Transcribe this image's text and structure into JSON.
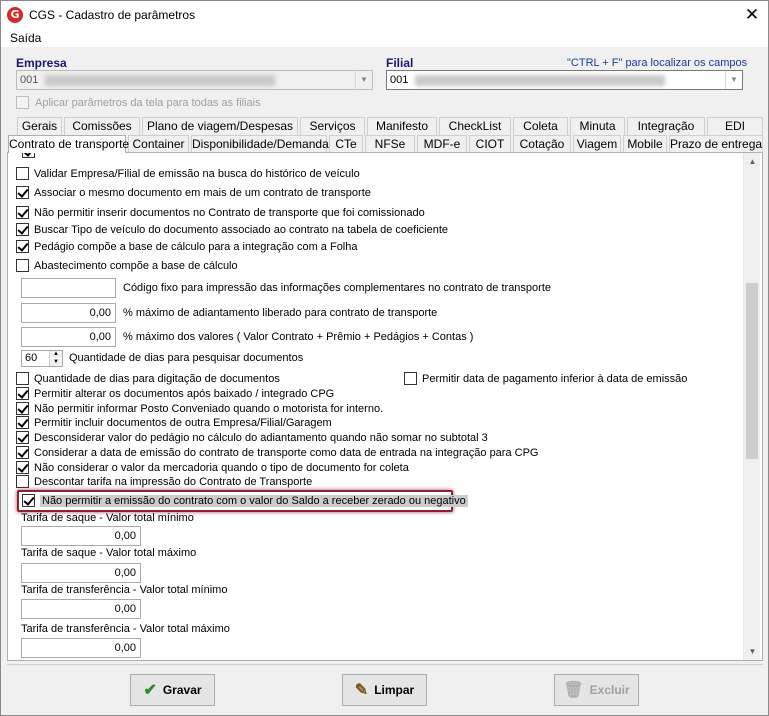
{
  "window": {
    "title": "CGS - Cadastro de parâmetros",
    "close": "✕"
  },
  "menu": {
    "saida": "Saída"
  },
  "header": {
    "empresa_label": "Empresa",
    "empresa_value": "001",
    "filial_label": "Filial",
    "filial_value": "001",
    "hint": "\"CTRL + F\" para localizar os campos",
    "apply_all": "Aplicar parâmetros da tela para todas as filiais"
  },
  "tabs_row1": [
    "Gerais",
    "Comissões",
    "Plano de viagem/Despesas",
    "Serviços",
    "Manifesto",
    "CheckList",
    "Coleta",
    "Minuta",
    "Integração",
    "EDI"
  ],
  "tabs_row2": [
    "Contrato de transporte",
    "Container",
    "Disponibilidade/Demanda",
    "CTe",
    "NFSe",
    "MDF-e",
    "CIOT",
    "Cotação",
    "Viagem",
    "Mobile",
    "Prazo de entrega"
  ],
  "options_top": [
    {
      "label": "Validar Empresa/Filial de emissão na busca do histórico de veículo",
      "checked": false
    },
    {
      "label": "Associar o mesmo documento em mais de um contrato de transporte",
      "checked": true
    },
    {
      "label": "Não permitir inserir documentos no Contrato de transporte que foi comissionado",
      "checked": true
    },
    {
      "label": "Buscar Tipo de veículo do documento associado ao contrato na tabela de coeficiente",
      "checked": true
    },
    {
      "label": "Pedágio compõe a base de cálculo para a integração com a Folha",
      "checked": true
    },
    {
      "label": "Abastecimento compõe a base de cálculo",
      "checked": false
    }
  ],
  "fields": {
    "codigo_fixo_label": "Código fixo para impressão das informações complementares no contrato de transporte",
    "codigo_fixo_value": "",
    "pct_adiant_label": "% máximo de adiantamento liberado para contrato de transporte",
    "pct_adiant_value": "0,00",
    "pct_valores_label": "% máximo dos valores ( Valor Contrato + Prêmio + Pedágios + Contas )",
    "pct_valores_value": "0,00",
    "dias_value": "60",
    "dias_label": "Quantidade de dias para pesquisar documentos"
  },
  "options_bottom": [
    {
      "label": "Quantidade de dias para digitação de documentos",
      "checked": false
    },
    {
      "label": "Permitir alterar os documentos após baixado / integrado CPG",
      "checked": true
    },
    {
      "label": "Não permitir informar Posto Conveniado quando o motorista for interno.",
      "checked": true
    },
    {
      "label": "Permitir incluir documentos de outra Empresa/Filial/Garagem",
      "checked": true
    },
    {
      "label": "Desconsiderar valor do pedágio no cálculo do adiantamento quando não somar no subtotal 3",
      "checked": true
    },
    {
      "label": "Considerar a data de emissão do contrato de transporte como data de entrada na integração para CPG",
      "checked": true
    },
    {
      "label": "Não considerar o valor da mercadoria quando o tipo de documento for coleta",
      "checked": true
    },
    {
      "label": "Descontar tarifa na impressão do Contrato de Transporte",
      "checked": false
    },
    {
      "label": "Não permitir a emissão do contrato com o valor do Saldo a receber zerado ou negativo",
      "checked": true
    }
  ],
  "option_right": {
    "label": "Permitir data de pagamento inferior à data de emissão",
    "checked": false
  },
  "tarifas": [
    {
      "label": "Tarifa de saque - Valor total mínimo",
      "value": "0,00"
    },
    {
      "label": "Tarifa de saque - Valor total máximo",
      "value": "0,00"
    },
    {
      "label": "Tarifa de transferência - Valor total mínimo",
      "value": "0,00"
    },
    {
      "label": "Tarifa de transferência - Valor total máximo",
      "value": "0,00"
    }
  ],
  "buttons": {
    "gravar": "Gravar",
    "limpar": "Limpar",
    "excluir": "Excluir"
  }
}
